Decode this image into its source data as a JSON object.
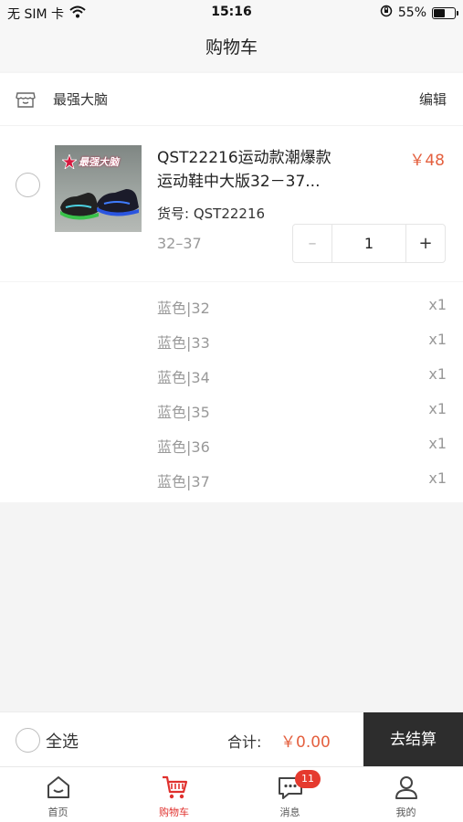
{
  "status_bar": {
    "carrier": "无 SIM 卡",
    "time": "15:16",
    "battery_percent": "55%",
    "battery_level": 0.55
  },
  "nav": {
    "title": "购物车"
  },
  "shop": {
    "name": "最强大脑",
    "edit_label": "编辑"
  },
  "product": {
    "title_line1": "QST22216运动款潮爆款",
    "title_line2": "运动鞋中大版32－37...",
    "price": "￥48",
    "sku": "货号: QST22216",
    "size_range": "32–37",
    "image_logo_text": "最强大脑",
    "quantity": "1",
    "minus_label": "–",
    "plus_label": "+"
  },
  "variants": [
    {
      "name": "蓝色|32",
      "qty": "x1"
    },
    {
      "name": "蓝色|33",
      "qty": "x1"
    },
    {
      "name": "蓝色|34",
      "qty": "x1"
    },
    {
      "name": "蓝色|35",
      "qty": "x1"
    },
    {
      "name": "蓝色|36",
      "qty": "x1"
    },
    {
      "name": "蓝色|37",
      "qty": "x1"
    }
  ],
  "checkout": {
    "select_all_label": "全选",
    "total_label": "合计:",
    "total_value": "￥0.00",
    "checkout_label": "去结算"
  },
  "tabs": [
    {
      "label": "首页",
      "icon": "home-icon"
    },
    {
      "label": "购物车",
      "icon": "cart-icon"
    },
    {
      "label": "消息",
      "icon": "message-icon",
      "badge": "11"
    },
    {
      "label": "我的",
      "icon": "profile-icon"
    }
  ],
  "colors": {
    "accent": "#e0312e",
    "price": "#e4603f",
    "checkout_button": "#2d2d2d"
  }
}
